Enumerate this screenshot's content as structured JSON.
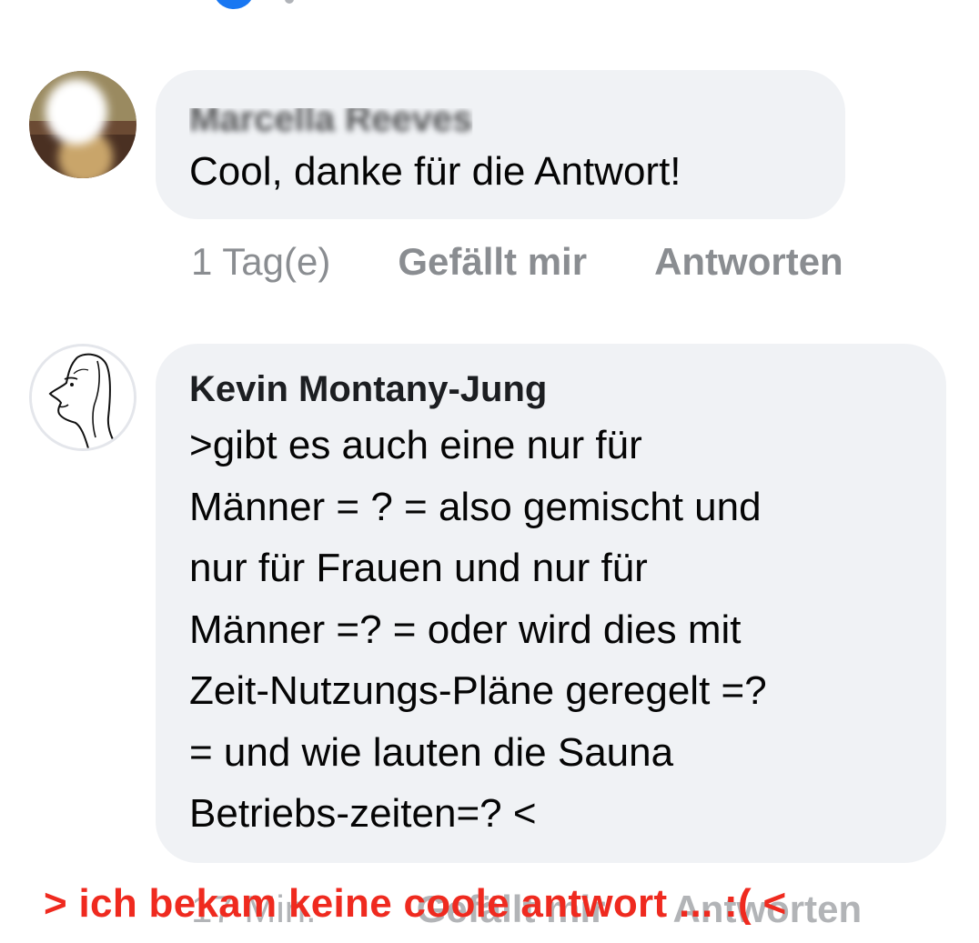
{
  "comments": [
    {
      "author": "Marcella Reeves",
      "text": "Cool, danke für die Antwort!",
      "timestamp": "1 Tag(e)",
      "like_label": "Gefällt mir",
      "reply_label": "Antworten"
    },
    {
      "author": "Kevin Montany-Jung",
      "text": ">gibt es auch eine nur für\nMänner = ? = also gemischt und\nnur für Frauen und nur für\nMänner =? = oder wird dies mit\nZeit-Nutzungs-Pläne geregelt =?\n= und wie lauten die  Sauna\nBetriebs-zeiten=? <",
      "timestamp": "17 Min.",
      "like_label": "Gefällt mir",
      "reply_label": "Antworten"
    }
  ],
  "overlay_text": "> ich bekam keine coole antwort ... :( <",
  "colors": {
    "bubble": "#f0f2f5",
    "meta_gray": "#8a8d91",
    "overlay_red": "#ef2a1f",
    "partial_avatar_blue": "#1877f2"
  }
}
